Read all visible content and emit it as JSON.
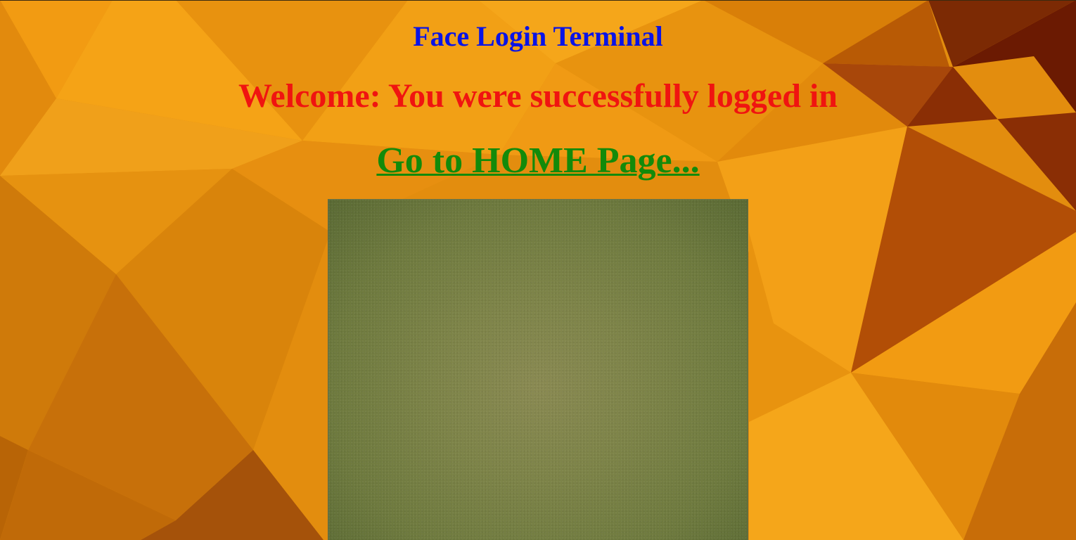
{
  "page": {
    "title": "Face Login Terminal",
    "welcome_message": "Welcome: You were successfully logged in",
    "home_link_label": "Go to HOME Page..."
  },
  "colors": {
    "title": "#0a14e6",
    "welcome": "#f01410",
    "link": "#138a0a",
    "background_main": "#e08a0c",
    "background_dark": "#9a3a05",
    "camera_feed": "#7d8448"
  }
}
